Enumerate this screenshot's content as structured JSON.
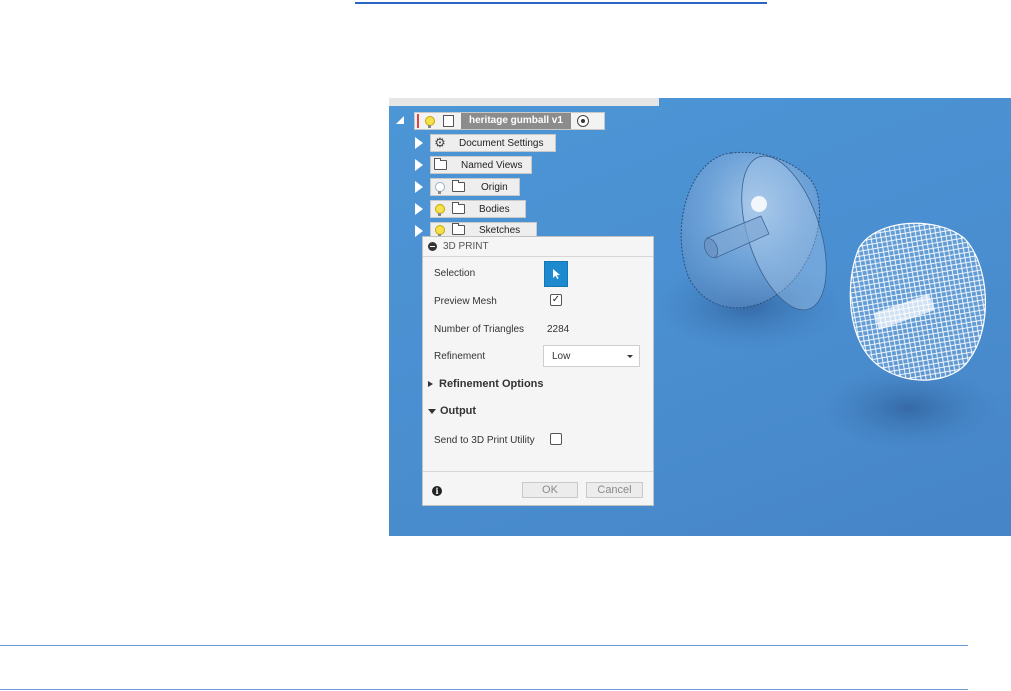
{
  "browser": {
    "root_name": "heritage gumball v1",
    "items": [
      {
        "label": "Document Settings"
      },
      {
        "label": "Named Views"
      },
      {
        "label": "Origin"
      },
      {
        "label": "Bodies"
      },
      {
        "label": "Sketches"
      }
    ]
  },
  "dialog": {
    "title": "3D PRINT",
    "selection_label": "Selection",
    "preview_mesh_label": "Preview Mesh",
    "preview_mesh_checked": true,
    "triangles_label": "Number of Triangles",
    "triangles_value": "2284",
    "refinement_label": "Refinement",
    "refinement_value": "Low",
    "refinement_options_label": "Refinement Options",
    "output_label": "Output",
    "send_label": "Send to 3D Print Utility",
    "send_checked": false,
    "ok_label": "OK",
    "cancel_label": "Cancel"
  },
  "colors": {
    "viewport_blue": "#4a8ed0",
    "selection_blue": "#1d8ad0",
    "rule_blue": "#2a64c4"
  }
}
